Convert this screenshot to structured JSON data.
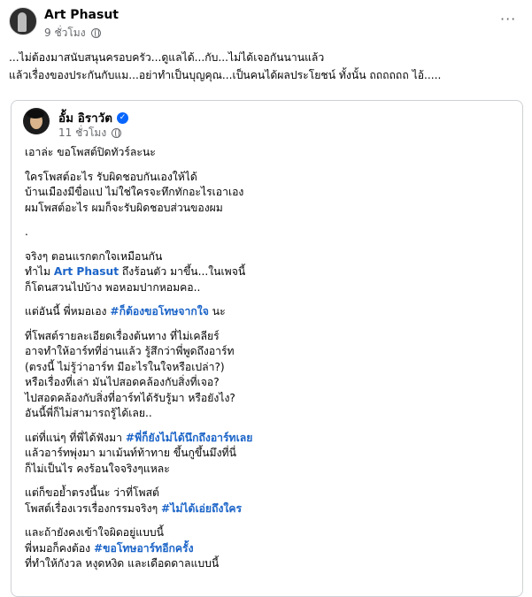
{
  "post": {
    "author": "Art Phasut",
    "time": "9 ชั่วโมง",
    "more_label": "···",
    "caption": "...ไม่ต้องมาสนับสนุนครอบครัว...ดูแลได้...กับ...ไม่ได้เจอกันนานแล้ว\nแล้วเรื่องของประกันกับแม...อย่าทำเป็นบุญคุณ...เป็นคนได้ผลประโยชน์ ทั้งนั้น ถถถถถถ ไอ้....."
  },
  "shared": {
    "author": "อั้ม อิราวัต",
    "verified_glyph": "✓",
    "time": "11 ชั่วโมง",
    "lines": {
      "l1": "เอาล่ะ ขอโพสต์ปิดทัวร์ละนะ",
      "l2": "ใครโพสต์อะไร รับผิดชอบกันเองให้ได้",
      "l3": "บ้านเมืองมีขื่อแป ไม่ใช่ใครจะทึกทักอะไรเอาเอง",
      "l4": "ผมโพสต์อะไร ผมก็จะรับผิดชอบส่วนของผม",
      "l5": ".",
      "l6": "จริงๆ ตอนแรกตกใจเหมือนกัน",
      "l7a": "ทำไม ",
      "l7b": "Art Phasut",
      "l7c": " ถึงร้อนตัว มาขึ้น...ในเพจนี้",
      "l8": "ก็โดนสวนไปบ้าง พอหอมปากหอมคอ..",
      "l9a": "แต่อันนี้ พี่หมอเอง ",
      "l9b": "#ก็ต้องขอโทษจากใจ",
      "l9c": " นะ",
      "l10": "ที่โพสต์รายละเอียดเรื่องต้นทาง ที่ไม่เคลียร์",
      "l11": "อาจทำให้อาร์ทที่อ่านแล้ว รู้สึกว่าพี่พูดถึงอาร์ท",
      "l12": "(ตรงนี้ ไม่รู้ว่าอาร์ท มีอะไรในใจหรือเปล่า?)",
      "l13": "หรือเรื่องที่เล่า มันไปสอดคล้องกับสิ่งที่เจอ?",
      "l14": "ไปสอดคล้องกับสิ่งที่อาร์ทได้รับรู้มา หรือยังไง?",
      "l15": "อันนี้พี่ก็ไม่สามารถรู้ได้เลย..",
      "l16a": "แต่ที่แน่ๆ ที่พี่ได้ฟังมา ",
      "l16b": "#พี่ก็ยังไม่ได้นึกถึงอาร์ทเลย",
      "l17": "แล้วอาร์ทพุ่งมา มาเม้นท์ท้าทาย ขึ้นกูขึ้นมึงที่นี่",
      "l18": "ก็ไม่เป็นไร คงร้อนใจจริงๆแหละ",
      "l19": "แต่ก็ขอย้ำตรงนี้นะ ว่าที่โพสต์",
      "l20a": "โพสต์เรื่องเวรเรื่องกรรมจริงๆ ",
      "l20b": "#ไม่ได้เอ่ยถึงใคร",
      "l21": "และถ้ายังคงเข้าใจผิดอยู่แบบนี้",
      "l22a": "พี่หมอก็คงต้อง ",
      "l22b": "#ขอโทษอาร์ทอีกครั้ง",
      "l23": "ที่ทำให้กังวล หงุดหงิด และเดือดดาลแบบนี้"
    }
  },
  "colors": {
    "link": "#1b64c8",
    "meta": "#65676b",
    "verified": "#0866ff"
  }
}
